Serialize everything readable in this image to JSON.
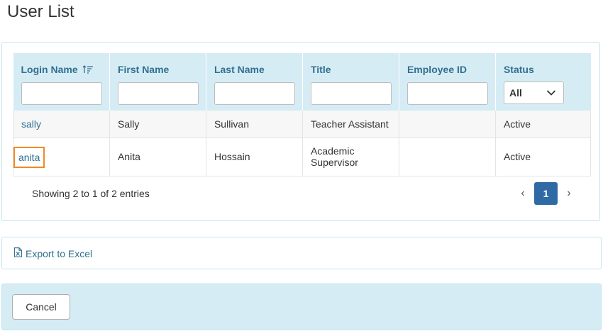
{
  "page": {
    "title": "User List"
  },
  "table": {
    "columns": [
      {
        "label": "Login Name",
        "sortable": true
      },
      {
        "label": "First Name"
      },
      {
        "label": "Last Name"
      },
      {
        "label": "Title"
      },
      {
        "label": "Employee ID"
      },
      {
        "label": "Status"
      }
    ],
    "filters": {
      "login_name": "",
      "first_name": "",
      "last_name": "",
      "title": "",
      "employee_id": "",
      "status_selected": "All"
    },
    "rows": [
      {
        "login": "sally",
        "first": "Sally",
        "last": "Sullivan",
        "title": "Teacher Assistant",
        "employee_id": "",
        "status": "Active"
      },
      {
        "login": "anita",
        "first": "Anita",
        "last": "Hossain",
        "title": "Academic Supervisor",
        "employee_id": "",
        "status": "Active"
      }
    ]
  },
  "footer": {
    "entries_info": "Showing 2 to 1 of 2 entries",
    "pager": {
      "prev": "‹",
      "current_page": "1",
      "next": "›"
    }
  },
  "export": {
    "label": "Export to Excel"
  },
  "actions": {
    "cancel_label": "Cancel"
  },
  "colors": {
    "accent": "#31708f",
    "header_bg": "#d6ecf5",
    "pager_active": "#2f6aa5",
    "highlight": "#f08a24"
  },
  "icons": {
    "sort": "sort-amount-icon",
    "select": "chevron-down-icon",
    "export": "excel-file-icon"
  }
}
